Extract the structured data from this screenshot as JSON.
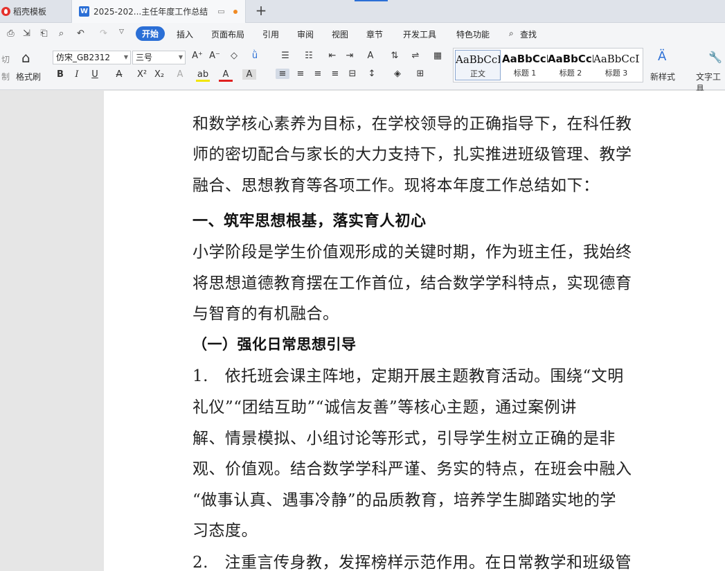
{
  "tabs": [
    {
      "label": "稻壳模板"
    },
    {
      "label": "2025-202...主任年度工作总结"
    }
  ],
  "menu": {
    "items": [
      "开始",
      "插入",
      "页面布局",
      "引用",
      "审阅",
      "视图",
      "章节",
      "开发工具",
      "特色功能",
      "查找"
    ],
    "active": "开始"
  },
  "ribbon": {
    "cut": "切",
    "copy": "制",
    "format_painter": "格式刷",
    "font_name": "仿宋_GB2312",
    "font_size": "三号",
    "styles": [
      {
        "sample": "AaBbCcDd",
        "label": "正文"
      },
      {
        "sample": "AaBbCcDd",
        "label": "标题 1"
      },
      {
        "sample": "AaBbCcDd",
        "label": "标题 2"
      },
      {
        "sample": "AaBbCcDd",
        "label": "标题 3"
      }
    ],
    "new_style": "新样式",
    "text_tools": "文字工具"
  },
  "document": {
    "lines": [
      "和数学核心素养为目标，在学校领导的正确指导下，在科任教",
      "师的密切配合与家长的大力支持下，扎实推进班级管理、教学",
      "融合、思想教育等各项工作。现将本年度工作总结如下：",
      "一、筑牢思想根基，落实育人初心",
      "小学阶段是学生价值观形成的关键时期，作为班主任，我始终",
      "将思想道德教育摆在工作首位，结合数学学科特点，实现德育",
      "与智育的有机融合。",
      "（一）强化日常思想引导",
      "1.　依托班会课主阵地，定期开展主题教育活动。围绕“文明",
      "礼仪”“团结互助”“诚信友善”等核心主题，通过案例讲",
      "解、情景模拟、小组讨论等形式，引导学生树立正确的是非",
      "观、价值观。结合数学学科严谨、务实的特点，在班会中融入",
      "“做事认真、遇事冷静”的品质教育，培养学生脚踏实地的学",
      "习态度。",
      "2.　注重言传身教，发挥榜样示范作用。在日常教学和班级管"
    ]
  }
}
